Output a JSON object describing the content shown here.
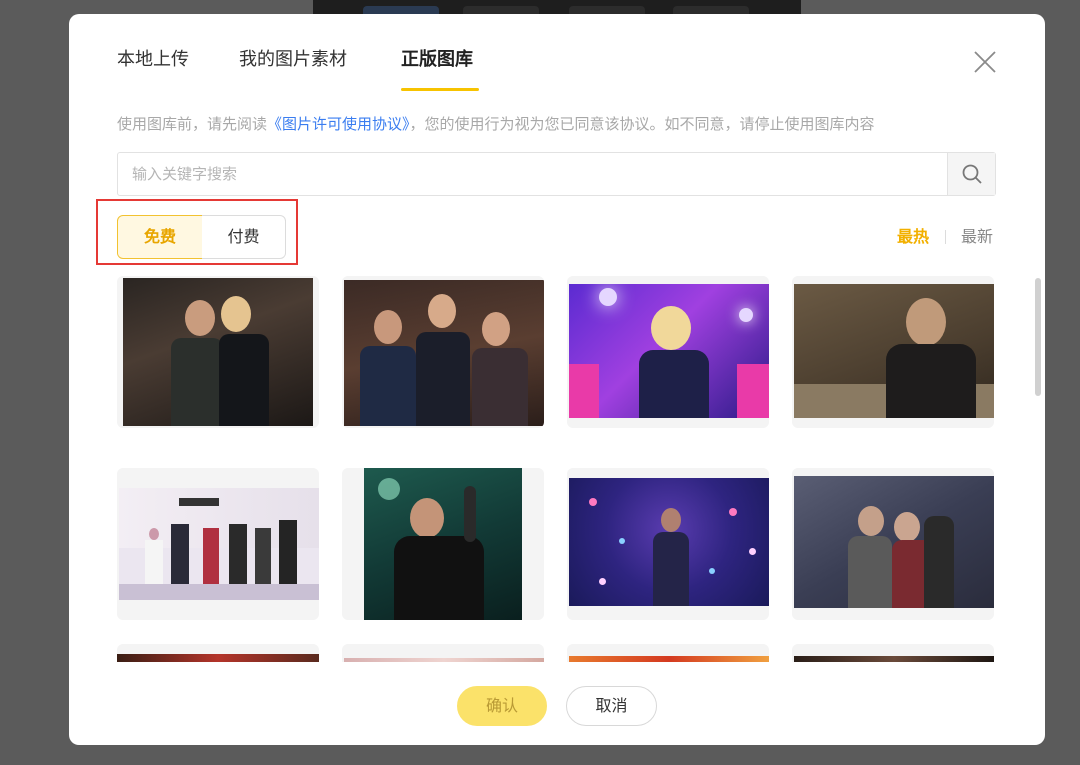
{
  "tabs": [
    {
      "label": "本地上传",
      "active": false
    },
    {
      "label": "我的图片素材",
      "active": false
    },
    {
      "label": "正版图库",
      "active": true
    }
  ],
  "notice": {
    "prefix": "使用图库前，请先阅读",
    "link": "《图片许可使用协议》",
    "suffix": "，您的使用行为视为您已同意该协议。如不同意，请停止使用图库内容"
  },
  "search": {
    "placeholder": "输入关键字搜索",
    "value": ""
  },
  "filter": {
    "free_label": "免费",
    "paid_label": "付费",
    "selected": "免费"
  },
  "sort": {
    "hot_label": "最热",
    "new_label": "最新",
    "selected": "最热"
  },
  "images": [
    {
      "name": "photo-1",
      "row": 1
    },
    {
      "name": "photo-2",
      "row": 1
    },
    {
      "name": "photo-3",
      "row": 1
    },
    {
      "name": "photo-4",
      "row": 1
    },
    {
      "name": "photo-5",
      "row": 2
    },
    {
      "name": "photo-6",
      "row": 2
    },
    {
      "name": "photo-7",
      "row": 2
    },
    {
      "name": "photo-8",
      "row": 2
    }
  ],
  "buttons": {
    "confirm_label": "确认",
    "cancel_label": "取消"
  },
  "colors": {
    "accent": "#f7c300",
    "link": "#3a7df0",
    "highlight": "#e53935"
  }
}
